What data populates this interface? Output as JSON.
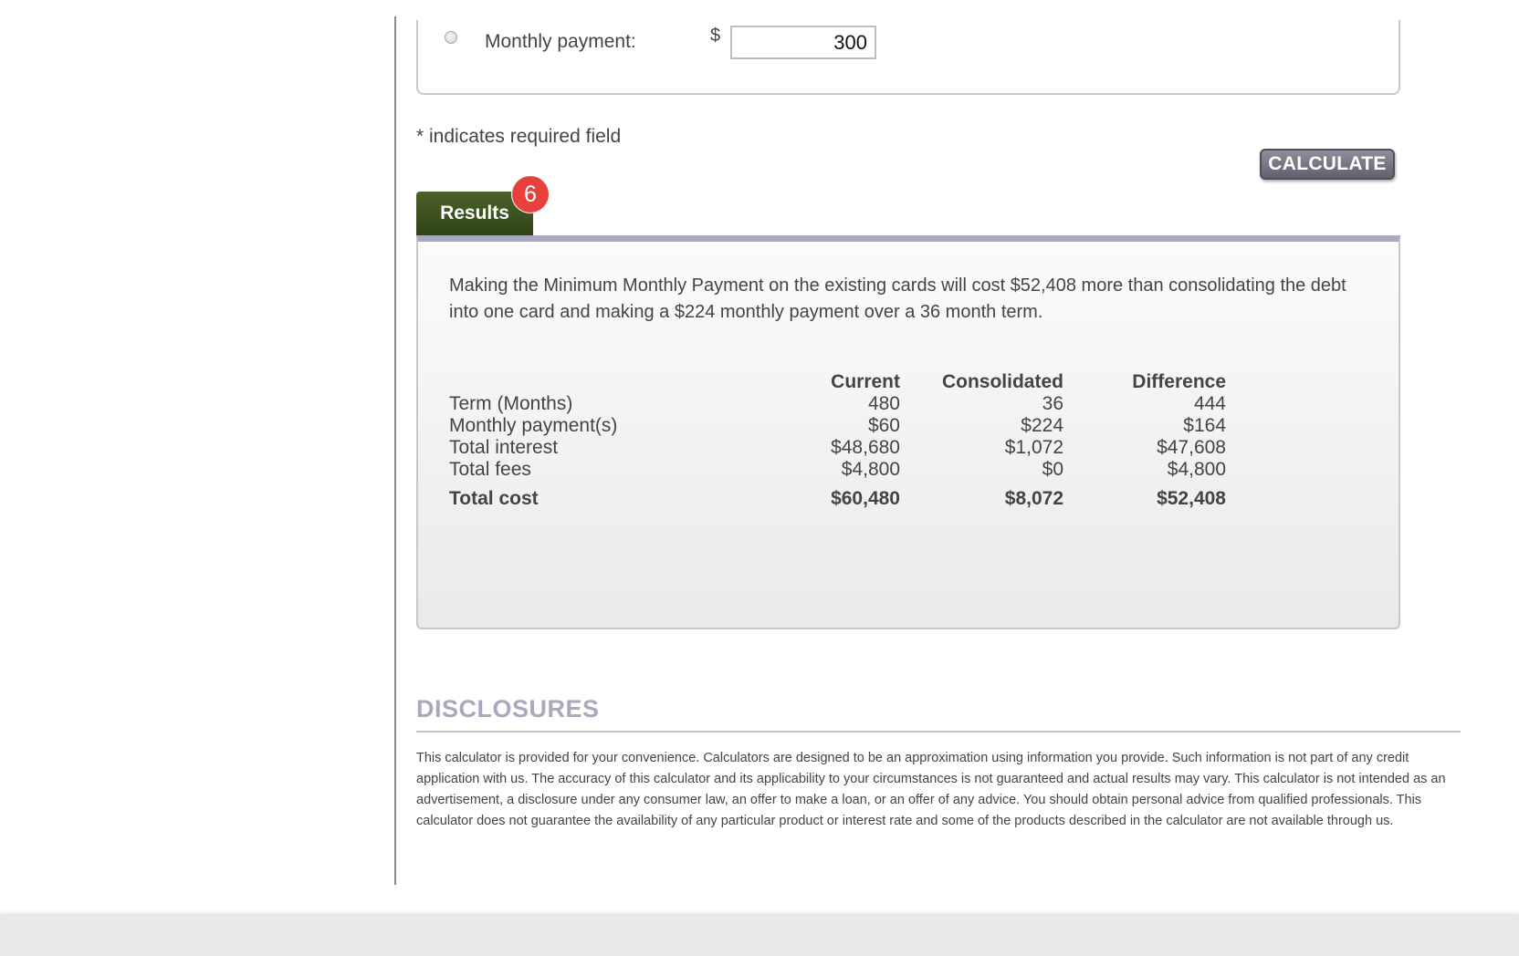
{
  "form": {
    "monthly_payment_label": "Monthly payment:",
    "currency_symbol": "$",
    "monthly_payment_value": "300",
    "required_note": "* indicates required field",
    "calculate_label": "CALCULATE"
  },
  "results": {
    "tab_label": "Results",
    "badge_count": "6",
    "summary": "Making the Minimum Monthly Payment on the existing cards will cost $52,408 more than consolidating the debt into one card and making a $224 monthly payment over a 36 month term.",
    "table": {
      "headers": [
        "Current",
        "Consolidated",
        "Difference"
      ],
      "rows": [
        {
          "label": "Term (Months)",
          "current": "480",
          "consolidated": "36",
          "difference": "444"
        },
        {
          "label": "Monthly payment(s)",
          "current": "$60",
          "consolidated": "$224",
          "difference": "$164"
        },
        {
          "label": "Total interest",
          "current": "$48,680",
          "consolidated": "$1,072",
          "difference": "$47,608"
        },
        {
          "label": "Total fees",
          "current": "$4,800",
          "consolidated": "$0",
          "difference": "$4,800"
        }
      ],
      "total": {
        "label": "Total cost",
        "current": "$60,480",
        "consolidated": "$8,072",
        "difference": "$52,408"
      }
    }
  },
  "disclosures": {
    "title": "DISCLOSURES",
    "text": "This calculator is provided for your convenience. Calculators are designed to be an approximation using information you provide. Such information is not part of any credit application with us. The accuracy of this calculator and its applicability to your circumstances is not guaranteed and actual results may vary. This calculator is not intended as an advertisement, a disclosure under any consumer law, an offer to make a loan, or an offer of any advice. You should obtain personal advice from qualified professionals. This calculator does not guarantee the availability of any particular product or interest rate and some of the products described in the calculator are not available through us."
  },
  "colors": {
    "tab_green": "#2f4416",
    "badge_red": "#e8403a",
    "accent_lavender": "#a9a8bf",
    "button_gray": "#6b6b77"
  }
}
